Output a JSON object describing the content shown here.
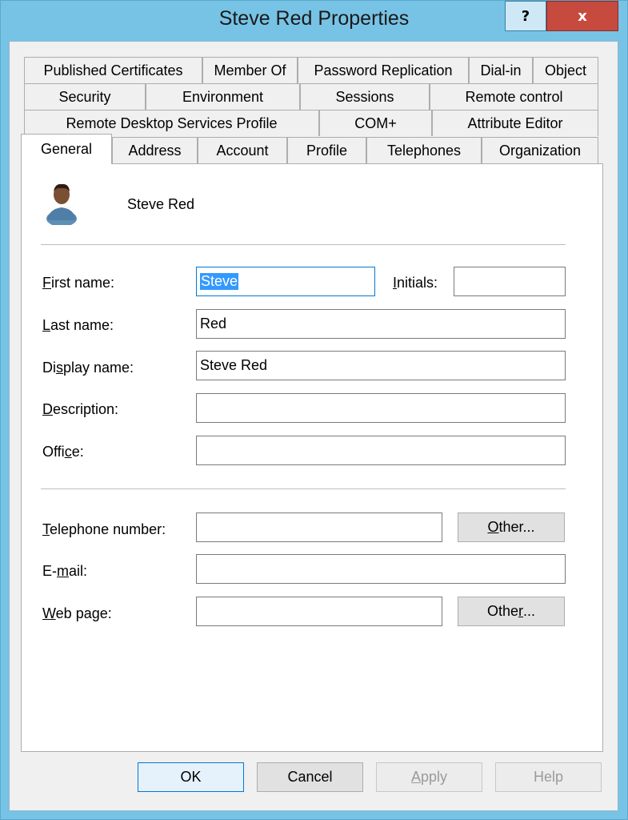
{
  "window": {
    "title": "Steve Red Properties",
    "help_glyph": "?",
    "close_glyph": "x"
  },
  "tabs": {
    "row1": [
      "Published Certificates",
      "Member Of",
      "Password Replication",
      "Dial-in",
      "Object"
    ],
    "row2": [
      "Security",
      "Environment",
      "Sessions",
      "Remote control"
    ],
    "row3": [
      "Remote Desktop Services Profile",
      "COM+",
      "Attribute Editor"
    ],
    "row4": [
      "General",
      "Address",
      "Account",
      "Profile",
      "Telephones",
      "Organization"
    ],
    "active": "General"
  },
  "general": {
    "user_icon": "user-icon",
    "display_header": "Steve Red",
    "labels": {
      "first_name": {
        "pre": "",
        "key": "F",
        "post": "irst name:"
      },
      "initials": {
        "pre": "",
        "key": "I",
        "post": "nitials:"
      },
      "last_name": {
        "pre": "",
        "key": "L",
        "post": "ast name:"
      },
      "display_name": {
        "pre": "Di",
        "key": "s",
        "post": "play name:"
      },
      "description": {
        "pre": "",
        "key": "D",
        "post": "escription:"
      },
      "office": {
        "pre": "Offi",
        "key": "c",
        "post": "e:"
      },
      "telephone": {
        "pre": "",
        "key": "T",
        "post": "elephone number:"
      },
      "email": {
        "pre": "E-",
        "key": "m",
        "post": "ail:"
      },
      "web_page": {
        "pre": "",
        "key": "W",
        "post": "eb page:"
      }
    },
    "values": {
      "first_name": "Steve",
      "initials": "",
      "last_name": "Red",
      "display_name": "Steve Red",
      "description": "",
      "office": "",
      "telephone": "",
      "email": "",
      "web_page": ""
    },
    "other_phone": {
      "pre": "",
      "key": "O",
      "post": "ther..."
    },
    "other_web": {
      "pre": "Othe",
      "key": "r",
      "post": "..."
    }
  },
  "footer": {
    "ok": "OK",
    "cancel": "Cancel",
    "apply": {
      "pre": "",
      "key": "A",
      "post": "pply"
    },
    "help": "Help"
  }
}
